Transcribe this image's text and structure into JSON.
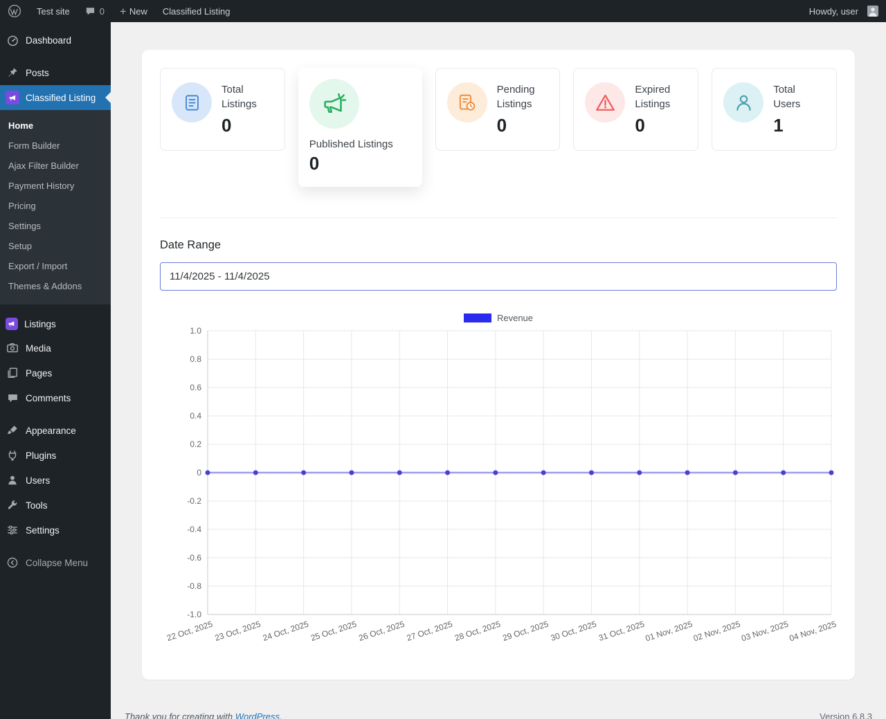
{
  "admin_bar": {
    "site_name": "Test site",
    "comments_count": "0",
    "new_label": "New",
    "page_shortcut": "Classified Listing",
    "howdy": "Howdy, user"
  },
  "sidebar": {
    "items": [
      {
        "label": "Dashboard"
      },
      {
        "label": "Posts"
      },
      {
        "label": "Classified Listing",
        "active": true
      },
      {
        "label": "Listings"
      },
      {
        "label": "Media"
      },
      {
        "label": "Pages"
      },
      {
        "label": "Comments"
      },
      {
        "label": "Appearance"
      },
      {
        "label": "Plugins"
      },
      {
        "label": "Users"
      },
      {
        "label": "Tools"
      },
      {
        "label": "Settings"
      },
      {
        "label": "Collapse Menu"
      }
    ],
    "submenu": [
      "Home",
      "Form Builder",
      "Ajax Filter Builder",
      "Payment History",
      "Pricing",
      "Settings",
      "Setup",
      "Export / Import",
      "Themes & Addons"
    ],
    "submenu_current": "Home"
  },
  "stats": [
    {
      "label": "Total Listings",
      "value": "0",
      "icon": "list-icon",
      "color": "#4688d9",
      "bg": "#d7e7f9"
    },
    {
      "label": "Published Listings",
      "value": "0",
      "icon": "megaphone-icon",
      "color": "#27ae60",
      "bg": "#e4f7ec"
    },
    {
      "label": "Pending Listings",
      "value": "0",
      "icon": "document-clock-icon",
      "color": "#ef8c3a",
      "bg": "#fcecd9"
    },
    {
      "label": "Expired Listings",
      "value": "0",
      "icon": "warning-triangle-icon",
      "color": "#f05a5a",
      "bg": "#fde7e7"
    },
    {
      "label": "Total Users",
      "value": "1",
      "icon": "user-icon",
      "color": "#4f9fae",
      "bg": "#dbf1f3"
    }
  ],
  "date_range": {
    "label": "Date Range",
    "value": "11/4/2025 - 11/4/2025"
  },
  "chart_data": {
    "type": "line",
    "title": "",
    "legend": [
      {
        "name": "Revenue",
        "color": "#2b2bf0"
      }
    ],
    "legend_position": "top",
    "x": [
      "22 Oct, 2025",
      "23 Oct, 2025",
      "24 Oct, 2025",
      "25 Oct, 2025",
      "26 Oct, 2025",
      "27 Oct, 2025",
      "28 Oct, 2025",
      "29 Oct, 2025",
      "30 Oct, 2025",
      "31 Oct, 2025",
      "01 Nov, 2025",
      "02 Nov, 2025",
      "03 Nov, 2025",
      "04 Nov, 2025"
    ],
    "series": [
      {
        "name": "Revenue",
        "values": [
          0,
          0,
          0,
          0,
          0,
          0,
          0,
          0,
          0,
          0,
          0,
          0,
          0,
          0
        ]
      }
    ],
    "ylim": [
      -1.0,
      1.0
    ],
    "ytick_step": 0.2,
    "grid": true,
    "line_color": "#9d9df2",
    "point_color": "#4343cd"
  },
  "footer": {
    "thanks_text": "Thank you for creating with",
    "link_label": "WordPress",
    "period": ".",
    "version": "Version 6.8.3"
  }
}
